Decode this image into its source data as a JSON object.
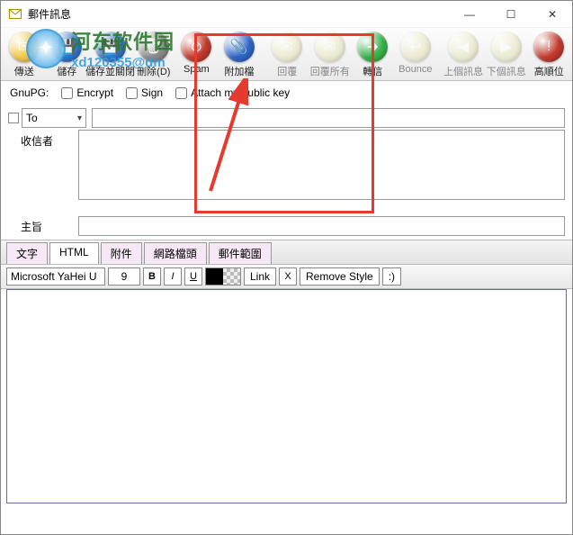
{
  "window": {
    "title": "郵件訊息",
    "min": "—",
    "max": "☐",
    "close": "✕"
  },
  "watermark": {
    "cn": "河东软件园",
    "url": "xd120355@dm"
  },
  "toolbar": [
    {
      "id": "send",
      "label": "傳送",
      "color": "#f2c94b",
      "glyph": "✉"
    },
    {
      "id": "save",
      "label": "儲存",
      "color": "#2f74c9",
      "glyph": "💾"
    },
    {
      "id": "saveclose",
      "label": "儲存並關閉",
      "color": "#2f74c9",
      "glyph": "💾"
    },
    {
      "id": "delete",
      "label": "刪除(D)",
      "color": "#8a8a8a",
      "glyph": "🗑"
    },
    {
      "id": "spam",
      "label": "Spam",
      "color": "#c23a2e",
      "glyph": "⊘"
    },
    {
      "id": "attach",
      "label": "附加檔",
      "color": "#2f64c9",
      "glyph": "📎"
    },
    {
      "id": "reply",
      "label": "回覆",
      "color": "#e8e6b8",
      "glyph": "✉",
      "disabled": true
    },
    {
      "id": "replyall",
      "label": "回覆所有",
      "color": "#e8e6b8",
      "glyph": "✉",
      "disabled": true
    },
    {
      "id": "forward",
      "label": "轉信",
      "color": "#37b34a",
      "glyph": "➜"
    },
    {
      "id": "bounce",
      "label": "Bounce",
      "color": "#e8e6b8",
      "glyph": "↩",
      "disabled": true
    },
    {
      "id": "prev",
      "label": "上個訊息",
      "color": "#e8e6b8",
      "glyph": "◀",
      "disabled": true
    },
    {
      "id": "next",
      "label": "下個訊息",
      "color": "#e8e6b8",
      "glyph": "▶",
      "disabled": true
    },
    {
      "id": "priority",
      "label": "高順位",
      "color": "#c23a2e",
      "glyph": "!"
    }
  ],
  "gnupg": {
    "label": "GnuPG:",
    "encrypt": "Encrypt",
    "sign": "Sign",
    "attach": "Attach my public key"
  },
  "addr": {
    "to": "To",
    "recipients": "收信者",
    "subject": "主旨"
  },
  "tabs": {
    "text": "文字",
    "html": "HTML",
    "attach": "附件",
    "headers": "網路檔頭",
    "template": "郵件範圍"
  },
  "format": {
    "font": "Microsoft YaHei U",
    "size": "9",
    "b": "B",
    "i": "I",
    "u": "U",
    "link": "Link",
    "x": "X",
    "remove": "Remove Style",
    "smile": ":)"
  }
}
